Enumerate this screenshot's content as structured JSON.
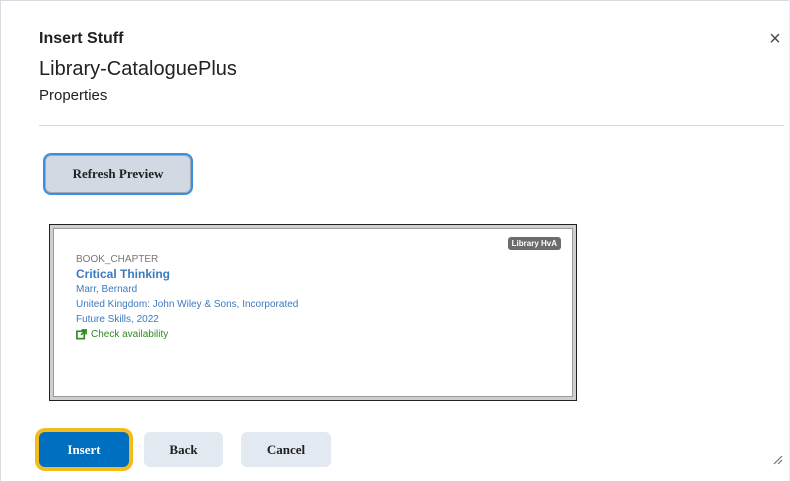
{
  "dialog": {
    "header_title": "Insert Stuff",
    "close_glyph": "×",
    "page_title": "Library-CataloguePlus",
    "page_subtitle": "Properties"
  },
  "toolbar": {
    "refresh_label": "Refresh Preview"
  },
  "preview": {
    "badge": "Library HvA",
    "record": {
      "type": "BOOK_CHAPTER",
      "title": "Critical Thinking",
      "author": "Marr, Bernard",
      "publisher": "United Kingdom: John Wiley & Sons, Incorporated",
      "series": "Future Skills, 2022",
      "availability": "Check availability",
      "availability_icon": "external-link-icon"
    }
  },
  "footer": {
    "insert_label": "Insert",
    "back_label": "Back",
    "cancel_label": "Cancel"
  },
  "colors": {
    "primary": "#006fbf",
    "focus_highlight": "#f4bb1c",
    "link": "#3c7abf",
    "availability": "#2e8b1f"
  }
}
